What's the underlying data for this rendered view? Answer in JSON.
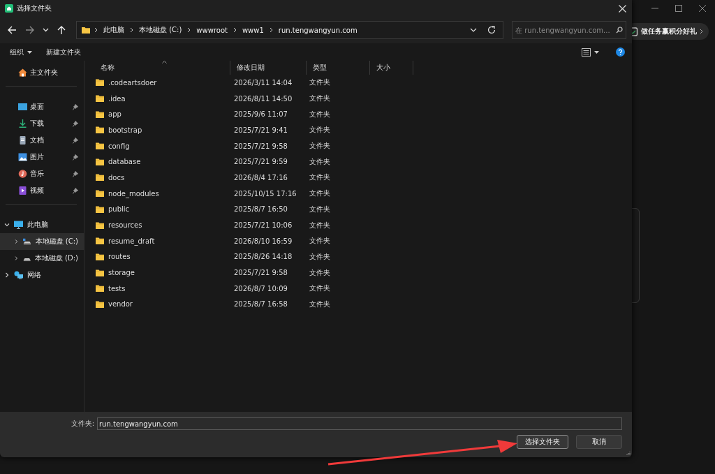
{
  "background_app": {
    "promo": "做任务赢积分好礼"
  },
  "dialog": {
    "title": "选择文件夹"
  },
  "navigation": {
    "crumbs": [
      "此电脑",
      "本地磁盘 (C:)",
      "wwwroot",
      "www1",
      "run.tengwangyun.com"
    ],
    "search": {
      "placeholder": "在 run.tengwangyun.com..."
    }
  },
  "toolbar": {
    "organize": "组织",
    "new_folder": "新建文件夹"
  },
  "sidebar": {
    "home": "主文件夹",
    "quick_access": [
      {
        "label": "桌面",
        "kind": "desktop",
        "pinned": true
      },
      {
        "label": "下载",
        "kind": "download",
        "pinned": true
      },
      {
        "label": "文档",
        "kind": "documents",
        "pinned": true
      },
      {
        "label": "图片",
        "kind": "pictures",
        "pinned": true
      },
      {
        "label": "音乐",
        "kind": "music",
        "pinned": true
      },
      {
        "label": "视频",
        "kind": "videos",
        "pinned": true
      }
    ],
    "tree": [
      {
        "label": "此电脑",
        "kind": "pc",
        "expanded": true,
        "selected": false,
        "children": [
          {
            "label": "本地磁盘 (C:)",
            "kind": "system-drive",
            "expanded": false,
            "selected": true
          },
          {
            "label": "本地磁盘 (D:)",
            "kind": "drive",
            "expanded": false,
            "selected": false
          }
        ]
      },
      {
        "label": "网络",
        "kind": "network",
        "expanded": false,
        "selected": false
      }
    ]
  },
  "table": {
    "columns": [
      {
        "label": "名称",
        "sorted": true
      },
      {
        "label": "修改日期",
        "sorted": false
      },
      {
        "label": "类型",
        "sorted": false
      },
      {
        "label": "大小",
        "sorted": false
      }
    ],
    "rows": [
      {
        "name": ".codeartsdoer",
        "date": "2026/3/11 14:04",
        "type": "文件夹"
      },
      {
        "name": ".idea",
        "date": "2026/8/11 14:50",
        "type": "文件夹"
      },
      {
        "name": "app",
        "date": "2025/9/6 11:07",
        "type": "文件夹"
      },
      {
        "name": "bootstrap",
        "date": "2025/7/21 9:41",
        "type": "文件夹"
      },
      {
        "name": "config",
        "date": "2025/7/21 9:58",
        "type": "文件夹"
      },
      {
        "name": "database",
        "date": "2025/7/21 9:59",
        "type": "文件夹"
      },
      {
        "name": "docs",
        "date": "2026/8/4 17:16",
        "type": "文件夹"
      },
      {
        "name": "node_modules",
        "date": "2025/10/15 17:16",
        "type": "文件夹"
      },
      {
        "name": "public",
        "date": "2025/8/7 16:50",
        "type": "文件夹"
      },
      {
        "name": "resources",
        "date": "2025/7/21 10:06",
        "type": "文件夹"
      },
      {
        "name": "resume_draft",
        "date": "2026/8/10 16:59",
        "type": "文件夹"
      },
      {
        "name": "routes",
        "date": "2025/8/26 14:18",
        "type": "文件夹"
      },
      {
        "name": "storage",
        "date": "2025/7/21 9:58",
        "type": "文件夹"
      },
      {
        "name": "tests",
        "date": "2026/8/7 10:09",
        "type": "文件夹"
      },
      {
        "name": "vendor",
        "date": "2025/8/7 16:58",
        "type": "文件夹"
      }
    ]
  },
  "footer": {
    "label": "文件夹:",
    "value": "run.tengwangyun.com",
    "buttons": [
      {
        "label": "选择文件夹",
        "default": true
      },
      {
        "label": "取消",
        "default": false
      }
    ]
  }
}
